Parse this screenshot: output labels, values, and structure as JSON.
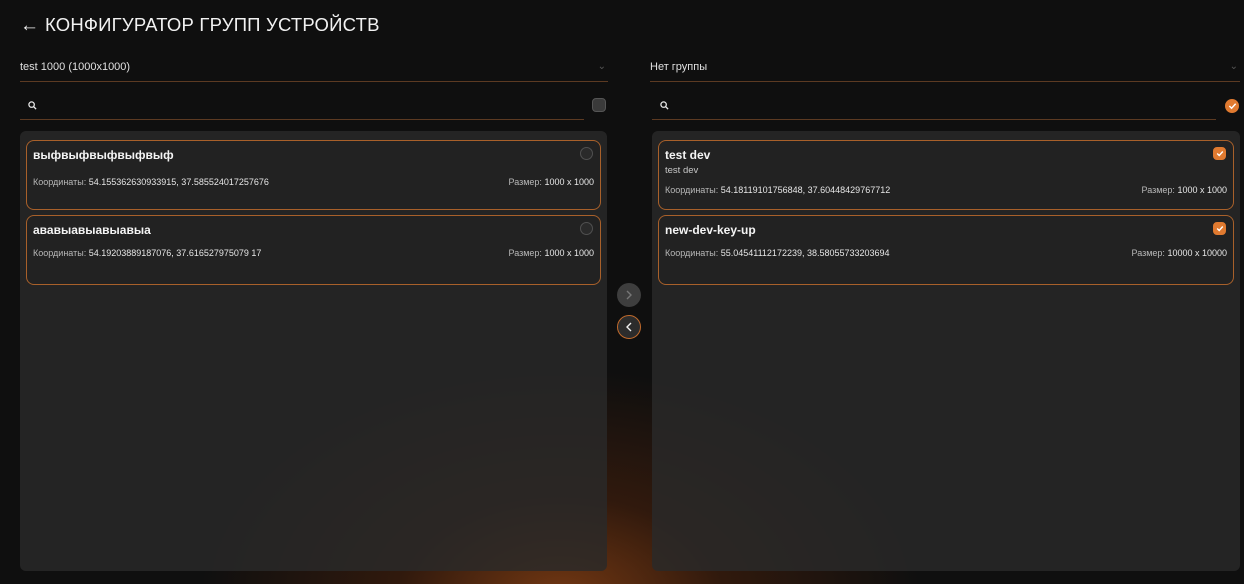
{
  "header": {
    "back_icon": "arrow-left-icon",
    "title": "КОНФИГУРАТОР ГРУПП УСТРОЙСТВ"
  },
  "left": {
    "select_value": "test 1000 (1000x1000)",
    "search_placeholder": "",
    "select_all_checked": false,
    "cards": [
      {
        "title": "выфвыфвыфвыфвыф",
        "coords_label": "Координаты:",
        "coords": "54.155362630933915, 37.585524017257676",
        "size_label": "Размер:",
        "size": "1000 x 1000",
        "checked": false
      },
      {
        "title": "ававыавыавыавыа",
        "coords_label": "Координаты:",
        "coords": "54.19203889187076, 37.616527975079 17",
        "size_label": "Размер:",
        "size": "1000 x 1000",
        "checked": false
      }
    ]
  },
  "right": {
    "select_value": "Нет группы",
    "search_placeholder": "",
    "select_all_checked": true,
    "cards": [
      {
        "title": "test dev",
        "subtitle": "test dev",
        "coords_label": "Координаты:",
        "coords": "54.18119101756848, 37.60448429767712",
        "size_label": "Размер:",
        "size": "1000 x 1000",
        "checked": true
      },
      {
        "title": "new-dev-key-up",
        "coords_label": "Координаты:",
        "coords": "55.04541112172239, 38.58055733203694",
        "size_label": "Размер:",
        "size": "10000 x 10000",
        "checked": true
      }
    ]
  },
  "transfer": {
    "move_right_icon": "chevron-right-icon",
    "move_left_icon": "chevron-left-icon"
  },
  "colors": {
    "accent": "#e07a30",
    "border": "#a8602a",
    "panel": "#2a2a2a",
    "background": "#0f0f0f"
  }
}
